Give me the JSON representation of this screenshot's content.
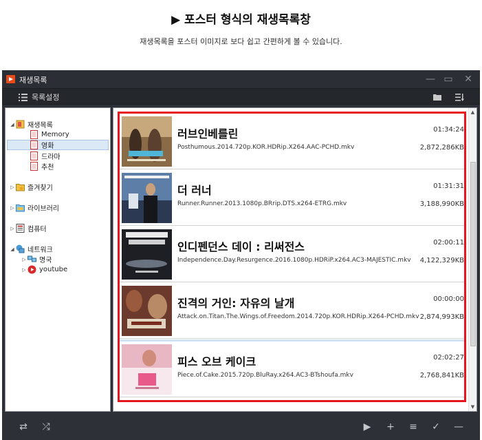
{
  "page": {
    "heading": "▶ 포스터 형식의 재생목록창",
    "subheading": "재생목록을 포스터 이미지로 보다 쉽고 간편하게 볼 수 있습니다."
  },
  "window": {
    "title": "재생목록",
    "controls": [
      "minimize",
      "maximize",
      "close"
    ]
  },
  "toolbar": {
    "list_settings_label": "목록설정"
  },
  "tree": {
    "playlist": {
      "label": "재생목록",
      "children": [
        "Memory",
        "영화",
        "드라마",
        "추천"
      ],
      "selected": "영화"
    },
    "favorites": "즐겨찾기",
    "library": "라이브러리",
    "computer": "컴퓨터",
    "network": {
      "label": "네트워크",
      "children": [
        "명국",
        "youtube"
      ]
    }
  },
  "items": [
    {
      "title": "러브인베를린",
      "file": "Posthumous.2014.720p.KOR.HDRip.X264.AAC-PCHD.mkv",
      "duration": "01:34:24",
      "size": "2,872,286KB",
      "poster_color": "#8a6b48"
    },
    {
      "title": "더 러너",
      "file": "Runner.Runner.2013.1080p.BRrip.DTS.x264-ETRG.mkv",
      "duration": "01:31:31",
      "size": "3,188,990KB",
      "poster_color": "#2b3a52"
    },
    {
      "title": "인디펜던스 데이 : 리써전스",
      "file": "Independence.Day.Resurgence.2016.1080p.HDRiP.x264.AC3-MAJESTIC.mkv",
      "duration": "02:00:11",
      "size": "4,122,329KB",
      "poster_color": "#1d1f24"
    },
    {
      "title": "진격의 거인: 자유의 날개",
      "file": "Attack.on.Titan.The.Wings.of.Freedom.2014.720p.KOR.HDRip.X264-PCHD.mkv",
      "duration": "00:00:00",
      "size": "2,874,993KB",
      "poster_color": "#6b3a2c"
    },
    {
      "title": "피스 오브 케이크",
      "file": "Piece.of.Cake.2015.720p.BluRay.x264.AC3-BTshoufa.mkv",
      "duration": "02:02:27",
      "size": "2,768,841KB",
      "poster_color": "#e9b6c3"
    }
  ],
  "colors": {
    "accent_frame": "#e6141c",
    "window_bg": "#2d3037",
    "selection": "#dbe8f5"
  }
}
